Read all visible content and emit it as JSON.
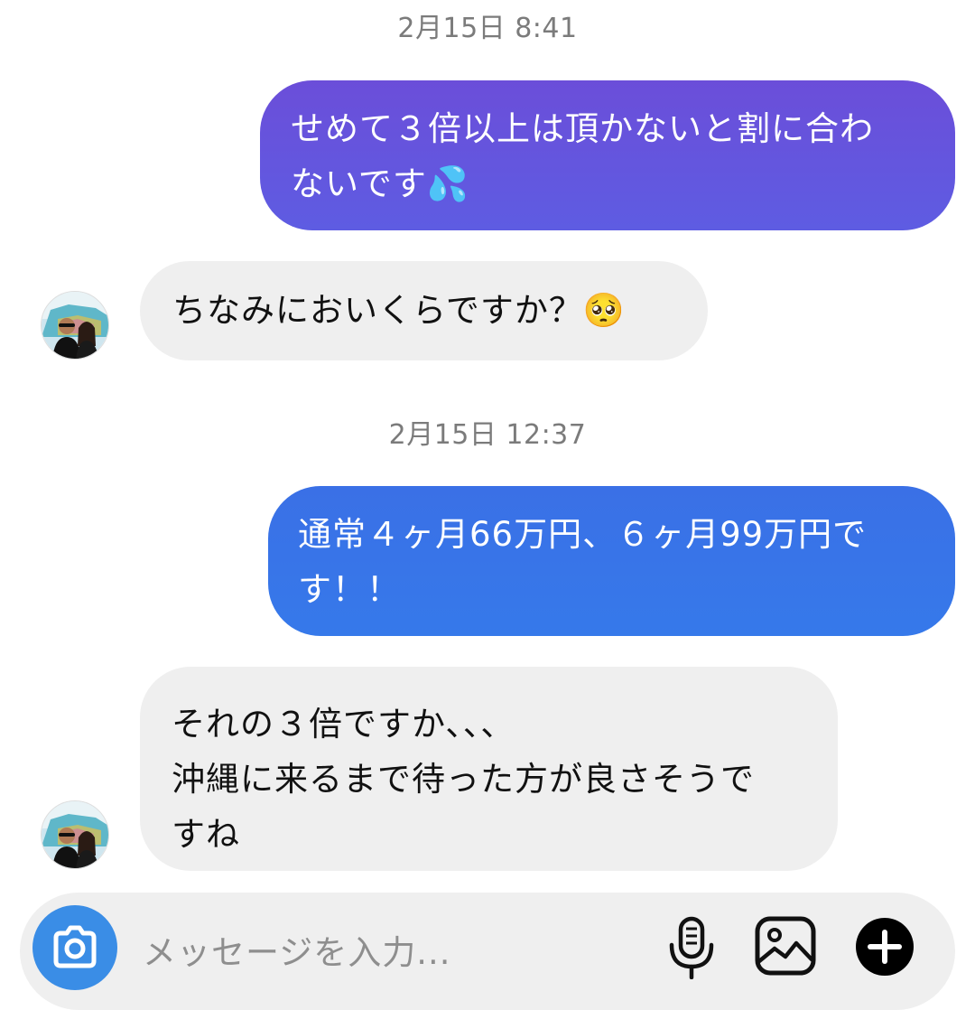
{
  "conversation": {
    "timestamps": [
      "2月15日 8:41",
      "2月15日 12:37"
    ],
    "messages": [
      {
        "direction": "outgoing",
        "lines": [
          "せめて３倍以上は頂かないと割に合わ",
          "ないです💦"
        ]
      },
      {
        "direction": "incoming",
        "lines": [
          "ちなみにおいくらですか？🥺"
        ]
      },
      {
        "direction": "outgoing",
        "lines": [
          "通常４ヶ月66万円、６ヶ月99万円で",
          "す！！"
        ]
      },
      {
        "direction": "incoming",
        "lines": [
          "それの３倍ですか、、、",
          "沖縄に来るまで待った方が良さそうで",
          "すね"
        ]
      }
    ]
  },
  "composer": {
    "placeholder": "メッセージを入力...",
    "icons": [
      "camera-icon",
      "microphone-icon",
      "image-icon",
      "plus-icon"
    ]
  },
  "colors": {
    "outgoing_purple": "#6451dd",
    "outgoing_blue": "#3677e8",
    "incoming_bg": "#efefef",
    "camera_bg": "#3a8de6"
  }
}
